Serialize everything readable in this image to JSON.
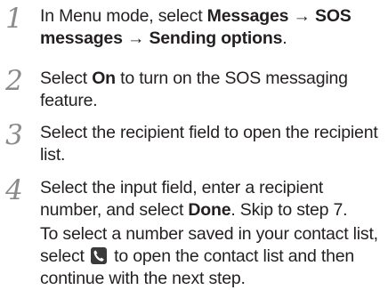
{
  "steps": [
    {
      "number": "1",
      "intro": "In Menu mode, select ",
      "path_a": "Messages",
      "arrow_a": " → ",
      "path_b": "SOS messages",
      "arrow_b": " → ",
      "path_c": "Sending options",
      "outro": "."
    },
    {
      "number": "2",
      "pre": "Select ",
      "bold": "On",
      "post": " to turn on the SOS messaging feature."
    },
    {
      "number": "3",
      "text": "Select the recipient field to open the recipient list."
    },
    {
      "number": "4",
      "pre": "Select the input field, enter a recipient number, and select ",
      "bold": "Done",
      "post": ". Skip to step 7.",
      "note_pre": "To select a number saved in your contact list, select ",
      "note_icon": "contacts-phone-icon",
      "note_post": " to open the contact list and then continue with the next step."
    }
  ]
}
